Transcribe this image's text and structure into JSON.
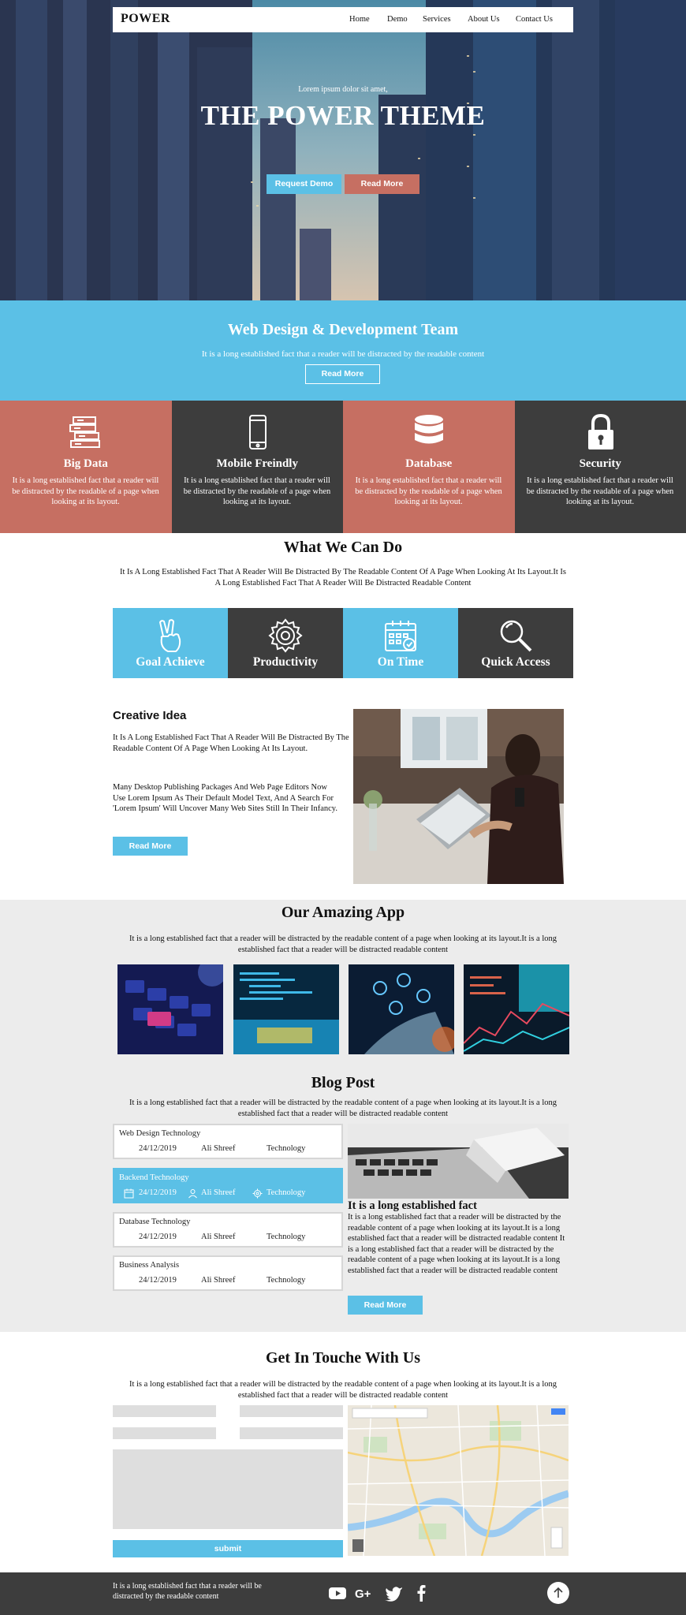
{
  "nav": {
    "brand": "POWER",
    "links": [
      "Home",
      "Demo",
      "Services",
      "About Us",
      "Contact Us"
    ]
  },
  "hero": {
    "kicker": "Lorem ipsum dolor sit amet,",
    "title": "THE POWER THEME",
    "btn_demo": "Request Demo",
    "btn_more": "Read More"
  },
  "team": {
    "title": "Web Design & Development Team",
    "subtitle": "It is a long established fact that a reader will be distracted by the readable content",
    "button": "Read More"
  },
  "features": [
    {
      "title": "Big Data",
      "desc": "It is a long established fact that a reader will be distracted by the readable of a page when looking at its layout.",
      "icon": "books-icon",
      "color": "#c66f62"
    },
    {
      "title": "Mobile Freindly",
      "desc": "It is a long established fact that a reader will be distracted by the readable of a page when looking at its layout.",
      "icon": "mobile-icon",
      "color": "#3d3d3d"
    },
    {
      "title": "Database",
      "desc": "It is a long established fact that a reader will be distracted by the readable of a page when looking at its layout.",
      "icon": "database-icon",
      "color": "#c66f62"
    },
    {
      "title": "Security",
      "desc": "It is a long established fact that a reader will be distracted by the readable of a page when looking at its layout.",
      "icon": "lock-icon",
      "color": "#3d3d3d"
    }
  ],
  "what": {
    "title": "What We Can Do",
    "subtitle": "It Is A Long Established Fact That A Reader Will Be Distracted By The Readable Content Of A Page When Looking At Its Layout.It Is A Long Established Fact That A Reader Will Be Distracted Readable Content",
    "tiles": [
      {
        "label": "Goal Achieve",
        "icon": "victory-hand-icon",
        "color": "#5bc0e6"
      },
      {
        "label": "Productivity",
        "icon": "gear-icon",
        "color": "#3d3d3d"
      },
      {
        "label": "On Time",
        "icon": "calendar-icon",
        "color": "#5bc0e6"
      },
      {
        "label": "Quick Access",
        "icon": "search-icon",
        "color": "#3d3d3d"
      }
    ]
  },
  "creative": {
    "title": "Creative Idea",
    "p1": "It Is A Long Established Fact That A Reader Will Be Distracted By The Readable Content Of A Page When Looking At Its Layout.",
    "p2": "Many Desktop Publishing Packages And Web Page Editors Now Use Lorem Ipsum As Their Default Model Text, And A Search For 'Lorem Ipsum' Will Uncover Many Web Sites Still In Their Infancy.",
    "button": "Read More"
  },
  "app": {
    "title": "Our Amazing App",
    "subtitle": "It is a long established fact that a reader will be distracted by the readable content of a page when looking at its layout.It is a long established fact that a reader will be distracted readable content"
  },
  "blog": {
    "title": "Blog Post",
    "subtitle": "It is a long established fact that a reader will be distracted by the readable content of a page when looking at its layout.It is a long established fact that a reader will be distracted readable content",
    "posts": [
      {
        "title": "Web Design Technology",
        "date": "24/12/2019",
        "author": "Ali Shreef",
        "category": "Technology"
      },
      {
        "title": "Backend Technology",
        "date": "24/12/2019",
        "author": "Ali Shreef",
        "category": "Technology"
      },
      {
        "title": "Database Technology",
        "date": "24/12/2019",
        "author": "Ali Shreef",
        "category": "Technology"
      },
      {
        "title": "Business Analysis",
        "date": "24/12/2019",
        "author": "Ali Shreef",
        "category": "Technology"
      }
    ],
    "feature_title": "It is a long established fact",
    "feature_body": "It is a long established fact that a reader will be distracted by the readable content of a page when looking at its layout.It is a long established fact that a reader will be distracted readable content It is a long established fact that a reader will be distracted by the readable content of a page when looking at its layout.It is a long established fact that a reader will be distracted readable content",
    "button": "Read More"
  },
  "contact": {
    "title": "Get In Touche With Us",
    "subtitle": "It is a long established fact that a reader will be distracted by the readable content of a page when looking at its layout.It is a long established fact that a reader will be distracted readable content",
    "submit": "submit"
  },
  "footer": {
    "text": "It is a long established fact that a reader will be distracted by the readable content",
    "social": [
      "youtube-icon",
      "google-plus-icon",
      "twitter-icon",
      "facebook-icon"
    ]
  },
  "colors": {
    "accent_blue": "#5bc0e6",
    "accent_salmon": "#c66f62",
    "dark": "#3d3d3d",
    "light_gray": "#ececec"
  }
}
